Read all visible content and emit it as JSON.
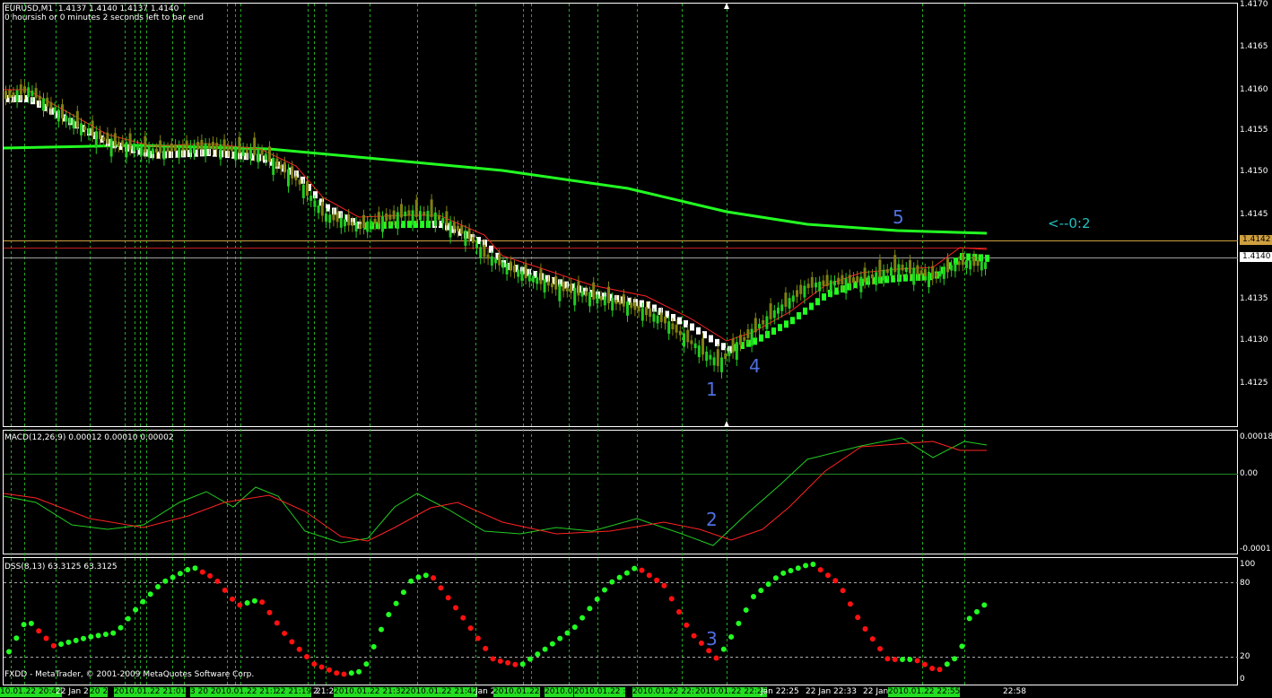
{
  "main": {
    "title": "EURUSD,M1  1.4137 1.4140 1.4137 1.4140",
    "subtitle": "0 hoursish or 0 minutes 2 seconds left to bar end",
    "price_labels": [
      "1.4170",
      "1.4165",
      "1.4160",
      "1.4155",
      "1.4150",
      "1.4145",
      "1.4135",
      "1.4130",
      "1.4125"
    ],
    "price_pills": {
      "level_a": "1.4142",
      "level_b": "1.4140"
    },
    "annotations": {
      "a1": "1",
      "a4": "4",
      "a5": "5"
    },
    "counter": "<--0:2"
  },
  "macd": {
    "title": "MACD(12,26,9) 0.00012 0.00010 0.00002",
    "labels": {
      "top": "0.00018",
      "zero": "0.00",
      "bottom": "-0.0001"
    },
    "annotation": "2"
  },
  "dss": {
    "title": "DSS(8,13) 63.3125 63.3125",
    "labels": {
      "l100": "100",
      "l80": "80",
      "l20": "20",
      "l0": "0"
    },
    "annotation": "3"
  },
  "footer": {
    "copyright": "FXDD - MetaTrader, © 2001-2009 MetaQuotes Software Corp."
  },
  "time_labels": [
    {
      "text": "10.01.22 20:44",
      "hl": true
    },
    {
      "text": "22 Jan 2",
      "hl": false
    },
    {
      "text": "20  2",
      "hl": true
    },
    {
      "text": "2010.01.22 21:01",
      "hl": true
    },
    {
      "text": "3 20  2010.01.22 21:14",
      "hl": true
    },
    {
      "text": "22 Jan 2",
      "hl": false
    },
    {
      "text": "22 21:19",
      "hl": true
    },
    {
      "text": "21:2",
      "hl": false
    },
    {
      "text": "2010.01.22 21:32",
      "hl": true
    },
    {
      "text": "2010.01.22 21:42",
      "hl": true
    },
    {
      "text": "Jan 2",
      "hl": false
    },
    {
      "text": "2010.01.22",
      "hl": true
    },
    {
      "text": "2010.0",
      "hl": true
    },
    {
      "text": "2010.01.22 :",
      "hl": true
    },
    {
      "text": "2010.01.22 22:11",
      "hl": true
    },
    {
      "text": "2010.01.22 22:22",
      "hl": true
    },
    {
      "text": "Jan 22:25",
      "hl": false
    },
    {
      "text": "22 Jan 22:33",
      "hl": false
    },
    {
      "text": "22 Jan",
      "hl": false
    },
    {
      "text": "2010.01.22 22:55",
      "hl": true
    },
    {
      "text": "22:58",
      "hl": false
    }
  ],
  "colors": {
    "grid": "#22aa22",
    "ma_green": "#22ff22",
    "ma_red": "#ff2222",
    "bull": "#22cc22",
    "bear": "#808010",
    "macd_main": "#22cc22",
    "macd_signal": "#ff2222",
    "level_orange": "#d0a040",
    "level_red": "#c02020",
    "level_grey": "#a0a0a0",
    "annotation": "#4f6fe0",
    "counter": "#22c0c0"
  }
}
